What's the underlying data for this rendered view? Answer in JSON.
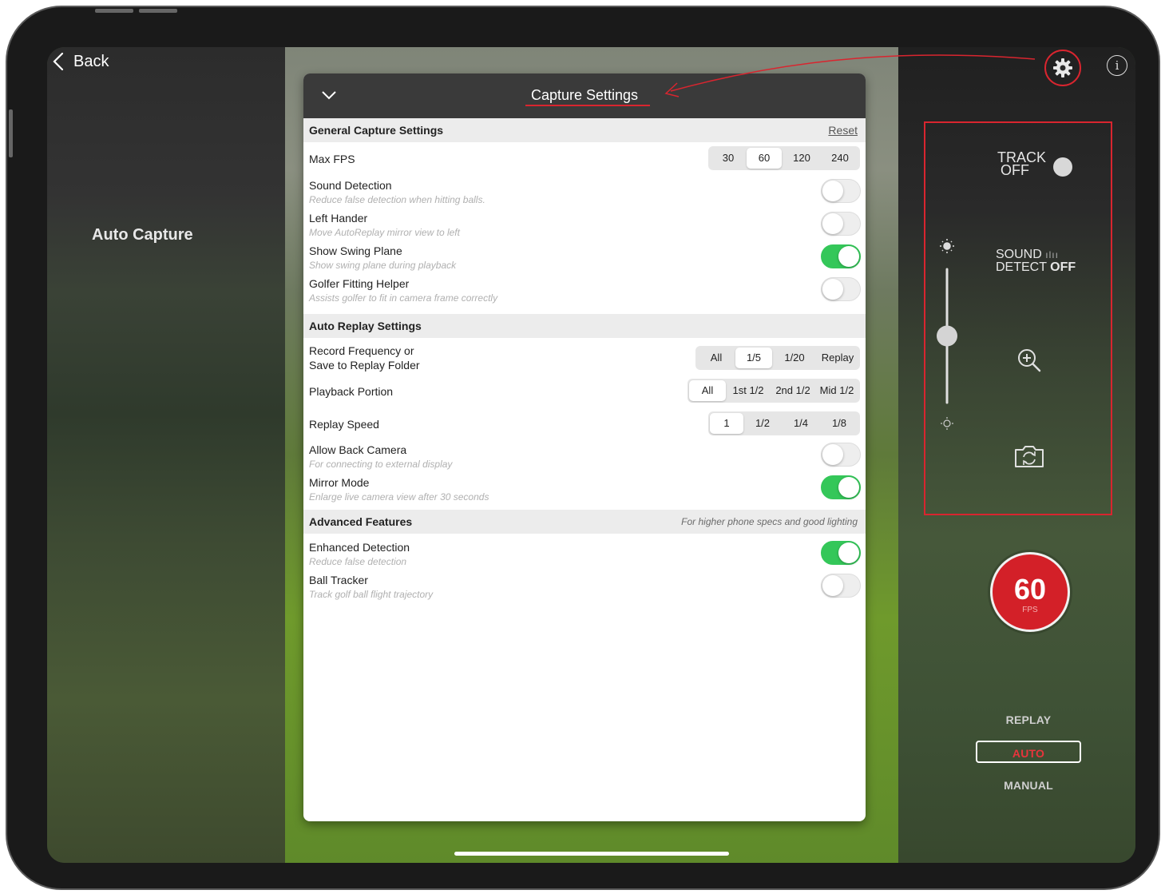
{
  "nav": {
    "back_label": "Back"
  },
  "left": {
    "title": "Auto Capture"
  },
  "panel": {
    "title": "Capture Settings",
    "general": {
      "header": "General Capture Settings",
      "reset_label": "Reset",
      "max_fps": {
        "label": "Max FPS",
        "options": [
          "30",
          "60",
          "120",
          "240"
        ],
        "selected": "60"
      },
      "sound_detection": {
        "label": "Sound Detection",
        "sub": "Reduce false detection when hitting balls.",
        "on": false
      },
      "left_hander": {
        "label": "Left Hander",
        "sub": "Move AutoReplay mirror view to left",
        "on": false
      },
      "show_swing_plane": {
        "label": "Show Swing Plane",
        "sub": "Show swing plane during playback",
        "on": true
      },
      "golfer_fitting_helper": {
        "label": "Golfer Fitting Helper",
        "sub": "Assists golfer to fit in camera frame correctly",
        "on": false
      }
    },
    "auto_replay": {
      "header": "Auto Replay Settings",
      "record_frequency": {
        "label_line1": "Record Frequency or",
        "label_line2": "Save to Replay Folder",
        "options": [
          "All",
          "1/5",
          "1/20",
          "Replay"
        ],
        "selected": "1/5"
      },
      "playback_portion": {
        "label": "Playback Portion",
        "options": [
          "All",
          "1st 1/2",
          "2nd 1/2",
          "Mid 1/2"
        ],
        "selected": "All"
      },
      "replay_speed": {
        "label": "Replay Speed",
        "options": [
          "1",
          "1/2",
          "1/4",
          "1/8"
        ],
        "selected": "1"
      },
      "allow_back_camera": {
        "label": "Allow Back Camera",
        "sub": "For connecting to external display",
        "on": false
      },
      "mirror_mode": {
        "label": "Mirror Mode",
        "sub": "Enlarge live camera view after 30 seconds",
        "on": true
      }
    },
    "advanced": {
      "header": "Advanced Features",
      "note": "For higher phone specs and good lighting",
      "enhanced_detection": {
        "label": "Enhanced Detection",
        "sub": "Reduce false detection",
        "on": true
      },
      "ball_tracker": {
        "label": "Ball Tracker",
        "sub": "Track golf ball flight trajectory",
        "on": false
      }
    }
  },
  "controls": {
    "track_line1": "TRACK",
    "track_line2": "OFF",
    "sound_line1": "SOUND",
    "sound_line2": "DETECT",
    "sound_state": "OFF",
    "brightness_level": 0.5,
    "fps_value": "60",
    "fps_unit": "FPS",
    "modes": {
      "replay": "REPLAY",
      "auto": "AUTO",
      "manual": "MANUAL"
    },
    "active_mode": "AUTO"
  },
  "colors": {
    "accent_red": "#d9252f",
    "toggle_on": "#34c759",
    "header_dark": "#3a3a3a"
  },
  "icons": [
    "chevron-left-icon",
    "chevron-down-icon",
    "gear-icon",
    "info-icon",
    "sun-icon",
    "zoom-in-icon",
    "camera-switch-icon"
  ]
}
